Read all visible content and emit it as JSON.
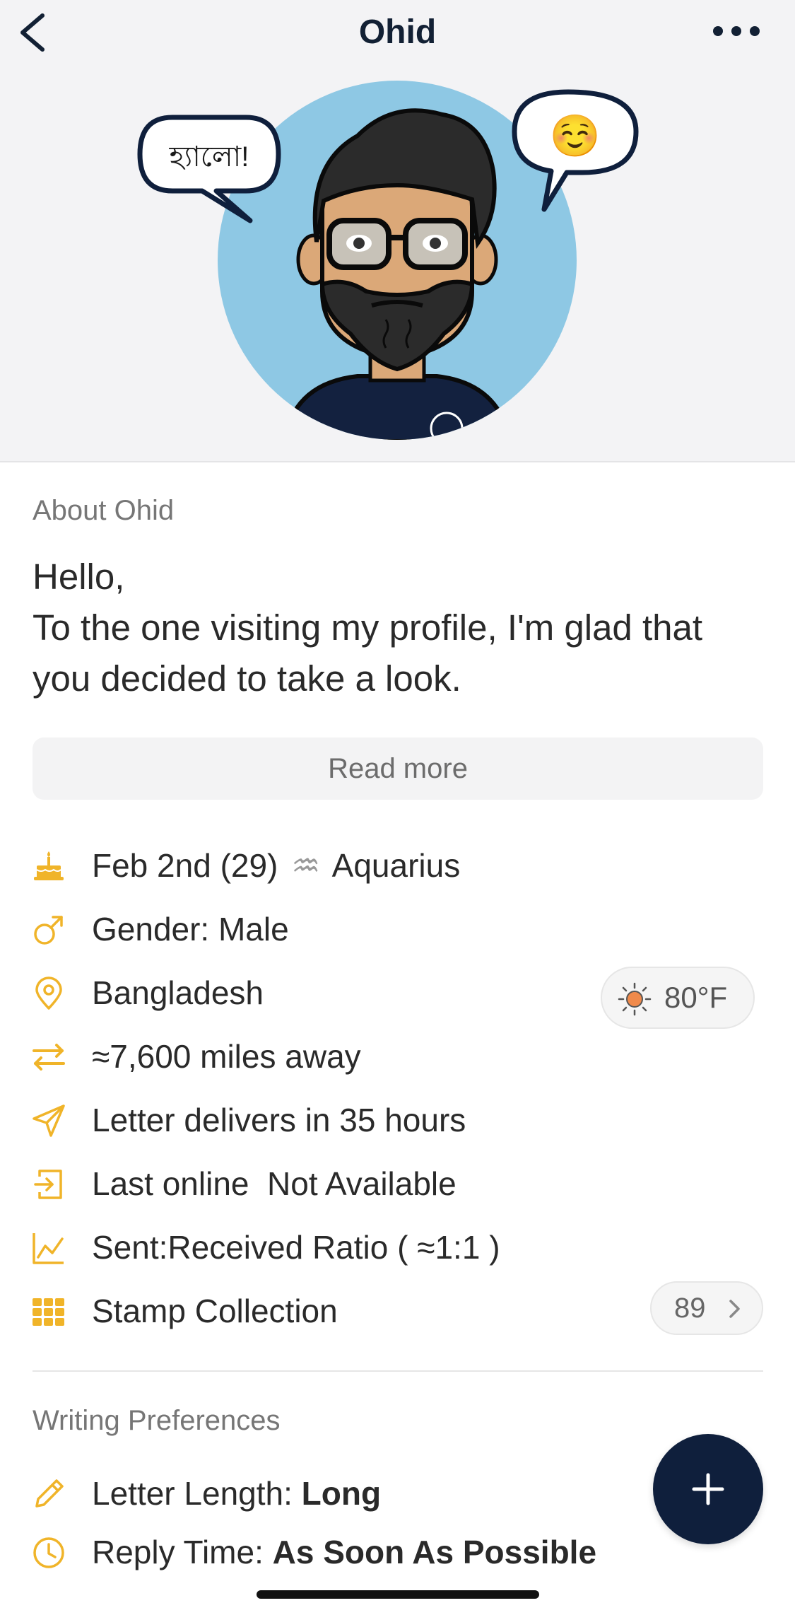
{
  "header": {
    "title": "Ohid",
    "back_icon": "chevron-left-icon",
    "more_icon": "more-horizontal-icon"
  },
  "avatar": {
    "speech_left": "হ্যালো!",
    "speech_right": "☺️"
  },
  "about": {
    "label": "About Ohid",
    "lines": [
      "Hello,",
      "To the one visiting my profile, I'm glad that",
      "you decided to take a look."
    ],
    "read_more": "Read more"
  },
  "info": {
    "birthday": "Feb 2nd (29)",
    "zodiac_symbol": "♒",
    "zodiac": "Aquarius",
    "gender": "Gender: Male",
    "location": "Bangladesh",
    "weather": "80°F",
    "distance": "≈7,600 miles away",
    "delivery": "Letter delivers in 35 hours",
    "last_online": "Last online  Not Available",
    "ratio": "Sent:Received Ratio ( ≈1:1 )",
    "stamps_label": "Stamp Collection",
    "stamps_count": "89"
  },
  "writing": {
    "label": "Writing Preferences",
    "length_label": "Letter Length: ",
    "length_value": "Long",
    "reply_label": "Reply Time: ",
    "reply_value": "As Soon As Possible"
  },
  "colors": {
    "accent_icon": "#f0b429",
    "navy": "#0f1f3c",
    "avatar_bg": "#8ec8e4"
  }
}
